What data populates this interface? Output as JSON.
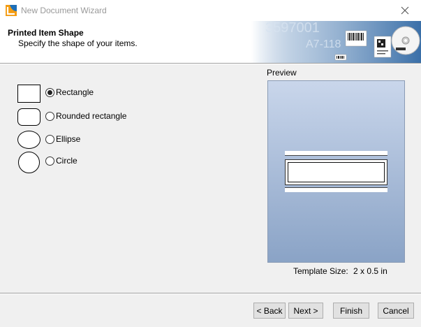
{
  "window": {
    "title": "New Document Wizard"
  },
  "header": {
    "title": "Printed Item Shape",
    "subtitle": "Specify the shape of your items.",
    "art_text": {
      "number": "3597001",
      "code": "A7-118"
    }
  },
  "shapes": [
    {
      "label": "Rectangle",
      "icon": "rectangle-shape-icon",
      "selected": true
    },
    {
      "label": "Rounded rectangle",
      "icon": "rounded-rectangle-shape-icon",
      "selected": false
    },
    {
      "label": "Ellipse",
      "icon": "ellipse-shape-icon",
      "selected": false
    },
    {
      "label": "Circle",
      "icon": "circle-shape-icon",
      "selected": false
    }
  ],
  "preview": {
    "label": "Preview",
    "template_size_label": "Template Size:",
    "template_size_value": "2 x 0.5 in"
  },
  "buttons": {
    "back": "< Back",
    "next": "Next >",
    "finish": "Finish",
    "cancel": "Cancel"
  },
  "colors": {
    "accent_orange": "#f39c12",
    "accent_blue": "#1e6fb8",
    "preview_top": "#c9d6eb",
    "preview_bottom": "#8aa3c6"
  }
}
